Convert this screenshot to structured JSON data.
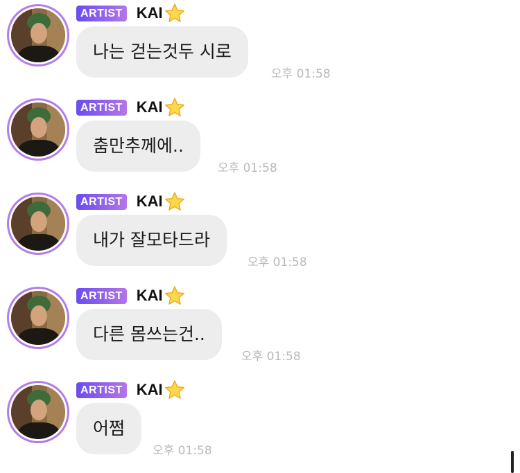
{
  "badge": {
    "label": "ARTIST",
    "gradient_start": "#6a4cf0",
    "gradient_end": "#b476e6"
  },
  "colors": {
    "avatar_ring": "#b57be8",
    "bubble_background": "#ededed",
    "timestamp_text": "#b9b9b9"
  },
  "messages": [
    {
      "sender": "KAI",
      "sender_icon": "star-icon",
      "text": "나는 걷는것두 시로",
      "time": "오후 01:58"
    },
    {
      "sender": "KAI",
      "sender_icon": "star-icon",
      "text": "춤만추께에..",
      "time": "오후 01:58"
    },
    {
      "sender": "KAI",
      "sender_icon": "star-icon",
      "text": "내가 잘모타드라",
      "time": "오후 01:58"
    },
    {
      "sender": "KAI",
      "sender_icon": "star-icon",
      "text": "다른 몸쓰는건..",
      "time": "오후 01:58"
    },
    {
      "sender": "KAI",
      "sender_icon": "star-icon",
      "text": "어쩜",
      "time": "오후 01:58"
    }
  ]
}
